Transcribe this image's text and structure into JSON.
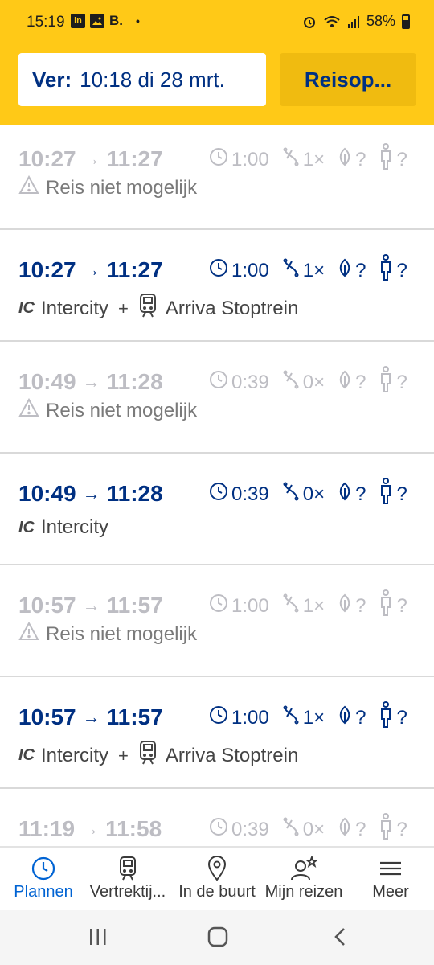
{
  "statusbar": {
    "time": "15:19",
    "notif_icons": [
      "linkedin-icon",
      "image-icon"
    ],
    "booking_letter": "B.",
    "dot": "•",
    "battery": "58%"
  },
  "header": {
    "ver_label": "Ver:",
    "ver_value": "10:18 di 28 mrt.",
    "options_button": "Reisop..."
  },
  "trips": [
    {
      "status": "dim",
      "depart": "10:27",
      "arrive": "11:27",
      "duration": "1:00",
      "transfers": "1×",
      "co2": "?",
      "crowd": "?",
      "warning": "Reis niet mogelijk"
    },
    {
      "status": "active",
      "depart": "10:27",
      "arrive": "11:27",
      "duration": "1:00",
      "transfers": "1×",
      "co2": "?",
      "crowd": "?",
      "legs": [
        {
          "badge": "IC",
          "name": "Intercity"
        },
        {
          "badge": "",
          "name": "Arriva Stoptrein"
        }
      ]
    },
    {
      "status": "dim",
      "depart": "10:49",
      "arrive": "11:28",
      "duration": "0:39",
      "transfers": "0×",
      "co2": "?",
      "crowd": "?",
      "warning": "Reis niet mogelijk"
    },
    {
      "status": "active",
      "depart": "10:49",
      "arrive": "11:28",
      "duration": "0:39",
      "transfers": "0×",
      "co2": "?",
      "crowd": "?",
      "legs": [
        {
          "badge": "IC",
          "name": "Intercity"
        }
      ]
    },
    {
      "status": "dim",
      "depart": "10:57",
      "arrive": "11:57",
      "duration": "1:00",
      "transfers": "1×",
      "co2": "?",
      "crowd": "?",
      "warning": "Reis niet mogelijk"
    },
    {
      "status": "active",
      "depart": "10:57",
      "arrive": "11:57",
      "duration": "1:00",
      "transfers": "1×",
      "co2": "?",
      "crowd": "?",
      "legs": [
        {
          "badge": "IC",
          "name": "Intercity"
        },
        {
          "badge": "",
          "name": "Arriva Stoptrein"
        }
      ]
    },
    {
      "status": "dim",
      "depart": "11:19",
      "arrive": "11:58",
      "duration": "0:39",
      "transfers": "0×",
      "co2": "?",
      "crowd": "?"
    }
  ],
  "leg_separator": "+",
  "arrow": "→",
  "bottomnav": [
    {
      "label": "Plannen",
      "icon": "clock-icon",
      "selected": true
    },
    {
      "label": "Vertrektij...",
      "icon": "train-icon",
      "selected": false
    },
    {
      "label": "In de buurt",
      "icon": "location-pin-icon",
      "selected": false
    },
    {
      "label": "Mijn reizen",
      "icon": "user-star-icon",
      "selected": false
    },
    {
      "label": "Meer",
      "icon": "menu-icon",
      "selected": false
    }
  ],
  "colors": {
    "header_yellow": "#ffc917",
    "ns_blue": "#003082",
    "dim_grey": "#bdbdc3",
    "warning_red": "#db0029",
    "selected_nav": "#0063d3"
  }
}
